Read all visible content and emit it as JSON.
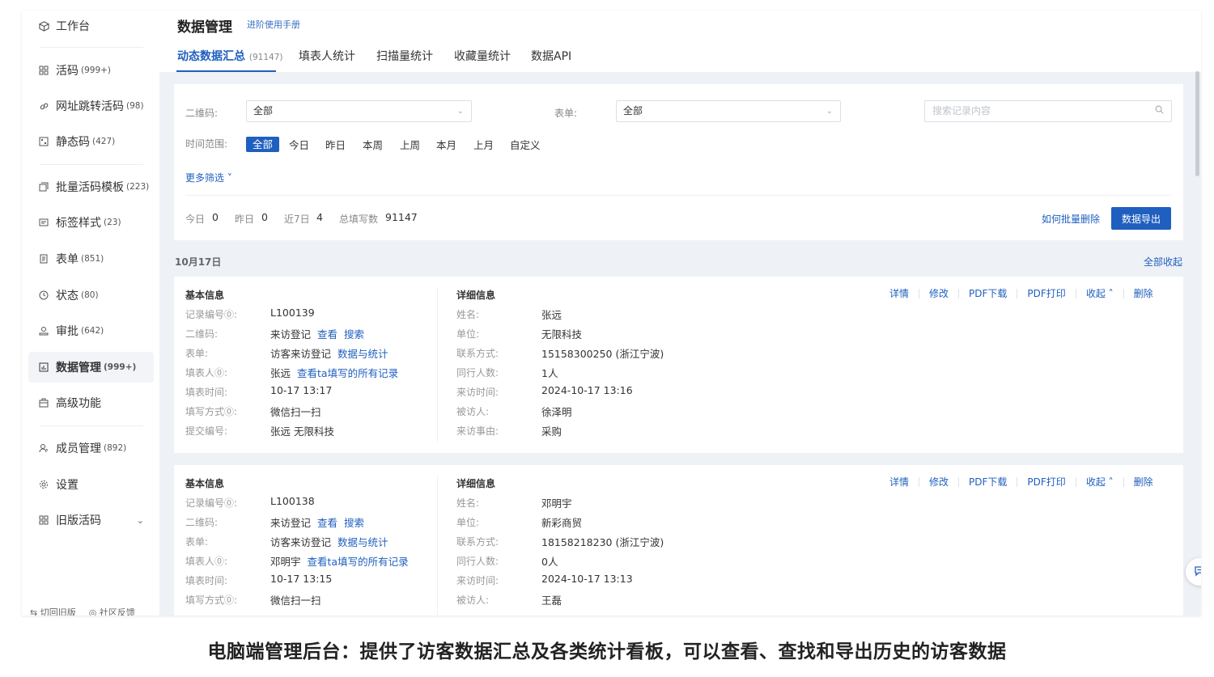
{
  "sidebar": {
    "items": [
      {
        "label": "工作台",
        "count": "",
        "icon": "cube-icon"
      },
      {
        "label": "活码",
        "count": "(999+)",
        "icon": "qr-grid-icon"
      },
      {
        "label": "网址跳转活码",
        "count": "(98)",
        "icon": "link-icon"
      },
      {
        "label": "静态码",
        "count": "(427)",
        "icon": "static-qr-icon"
      },
      {
        "label": "批量活码模板",
        "count": "(223)",
        "icon": "template-icon"
      },
      {
        "label": "标签样式",
        "count": "(23)",
        "icon": "label-style-icon"
      },
      {
        "label": "表单",
        "count": "(851)",
        "icon": "form-icon"
      },
      {
        "label": "状态",
        "count": "(80)",
        "icon": "status-icon"
      },
      {
        "label": "审批",
        "count": "(642)",
        "icon": "approval-icon"
      },
      {
        "label": "数据管理",
        "count": "(999+)",
        "icon": "chart-icon"
      },
      {
        "label": "高级功能",
        "count": "",
        "icon": "briefcase-icon"
      },
      {
        "label": "成员管理",
        "count": "(892)",
        "icon": "members-icon"
      },
      {
        "label": "设置",
        "count": "",
        "icon": "gear-icon"
      },
      {
        "label": "旧版活码",
        "count": "",
        "icon": "old-qr-icon"
      }
    ],
    "bottom_left": "⇆ 切回旧版",
    "bottom_right": "◎ 社区反馈"
  },
  "header": {
    "title": "数据管理",
    "manual_link": "进阶使用手册",
    "tabs": [
      {
        "label": "动态数据汇总",
        "count": "(91147)"
      },
      {
        "label": "填表人统计",
        "count": ""
      },
      {
        "label": "扫描量统计",
        "count": ""
      },
      {
        "label": "收藏量统计",
        "count": ""
      },
      {
        "label": "数据API",
        "count": ""
      }
    ]
  },
  "filters": {
    "qr_label": "二维码:",
    "qr_value": "全部",
    "form_label": "表单:",
    "form_value": "全部",
    "search_placeholder": "搜索记录内容",
    "time_label": "时间范围:",
    "time_options": [
      "全部",
      "今日",
      "昨日",
      "本周",
      "上周",
      "本月",
      "上月",
      "自定义"
    ],
    "time_selected": "全部",
    "more": "更多筛选 ˅"
  },
  "stats": {
    "today_label": "今日",
    "today": "0",
    "yesterday_label": "昨日",
    "yesterday": "0",
    "week_label": "近7日",
    "week": "4",
    "total_label": "总填写数",
    "total": "91147",
    "batch_delete": "如何批量删除",
    "export": "数据导出"
  },
  "list": {
    "date": "10月17日",
    "collapse_all": "全部收起",
    "basic_title": "基本信息",
    "detail_title": "详细信息",
    "actions": [
      "详情",
      "修改",
      "PDF下载",
      "PDF打印",
      "收起 ˄",
      "删除"
    ],
    "records": [
      {
        "basic": [
          {
            "label": "记录编号⓪:",
            "value": "L100139",
            "links": []
          },
          {
            "label": "二维码:",
            "value": "来访登记",
            "links": [
              "查看",
              "搜索"
            ]
          },
          {
            "label": "表单:",
            "value": "访客来访登记",
            "links": [
              "数据与统计"
            ]
          },
          {
            "label": "填表人⓪:",
            "value": "张远",
            "links": [
              "查看ta填写的所有记录"
            ]
          },
          {
            "label": "填表时间:",
            "value": "10-17 13:17",
            "links": []
          },
          {
            "label": "填写方式⓪:",
            "value": "微信扫一扫",
            "links": []
          },
          {
            "label": "提交编号:",
            "value": "张远 无限科技",
            "links": []
          }
        ],
        "detail": [
          {
            "label": "姓名:",
            "value": "张远"
          },
          {
            "label": "单位:",
            "value": "无限科技"
          },
          {
            "label": "联系方式:",
            "value": "15158300250 (浙江宁波)"
          },
          {
            "label": "同行人数:",
            "value": "1人"
          },
          {
            "label": "来访时间:",
            "value": "2024-10-17 13:16"
          },
          {
            "label": "被访人:",
            "value": "徐泽明"
          },
          {
            "label": "来访事由:",
            "value": "采购"
          }
        ]
      },
      {
        "basic": [
          {
            "label": "记录编号⓪:",
            "value": "L100138",
            "links": []
          },
          {
            "label": "二维码:",
            "value": "来访登记",
            "links": [
              "查看",
              "搜索"
            ]
          },
          {
            "label": "表单:",
            "value": "访客来访登记",
            "links": [
              "数据与统计"
            ]
          },
          {
            "label": "填表人⓪:",
            "value": "邓明宇",
            "links": [
              "查看ta填写的所有记录"
            ]
          },
          {
            "label": "填表时间:",
            "value": "10-17 13:15",
            "links": []
          },
          {
            "label": "填写方式⓪:",
            "value": "微信扫一扫",
            "links": []
          }
        ],
        "detail": [
          {
            "label": "姓名:",
            "value": "邓明宇"
          },
          {
            "label": "单位:",
            "value": "新彩商贸"
          },
          {
            "label": "联系方式:",
            "value": "18158218230 (浙江宁波)"
          },
          {
            "label": "同行人数:",
            "value": "0人"
          },
          {
            "label": "来访时间:",
            "value": "2024-10-17 13:13"
          },
          {
            "label": "被访人:",
            "value": "王磊"
          }
        ]
      }
    ]
  },
  "caption": "电脑端管理后台：提供了访客数据汇总及各类统计看板，可以查看、查找和导出历史的访客数据",
  "colors": {
    "accent": "#1f5fbf",
    "background": "#eef1f5"
  }
}
